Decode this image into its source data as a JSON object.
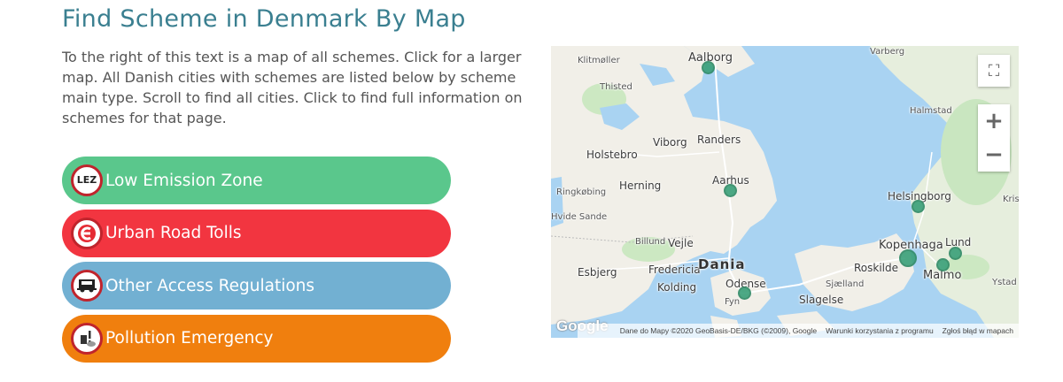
{
  "page": {
    "title": "Find Scheme in Denmark By Map",
    "intro": "To the right of this text is a map of all schemes. Click for a larger map. All Danish cities with schemes are listed below by scheme main type. Scroll to find all cities. Click to find full information on schemes for that page."
  },
  "schemes": [
    {
      "label": "Low Emission Zone",
      "color": "#5ac78c",
      "icon": "lez-sign-icon",
      "icon_text": "LEZ"
    },
    {
      "label": "Urban Road Tolls",
      "color": "#f23540",
      "icon": "road-toll-icon"
    },
    {
      "label": "Other Access Regulations",
      "color": "#72b0d2",
      "icon": "truck-prohibited-icon"
    },
    {
      "label": "Pollution Emergency",
      "color": "#f07f0e",
      "icon": "pollution-emergency-icon"
    }
  ],
  "map": {
    "country_label": "Dania",
    "cities": {
      "aalborg": "Aalborg",
      "klitmoller": "Klitmøller",
      "thisted": "Thisted",
      "varberg": "Varberg",
      "halmstad": "Halmstad",
      "viborg": "Viborg",
      "randers": "Randers",
      "holstebro": "Holstebro",
      "herning": "Herning",
      "aarhus": "Aarhus",
      "ringkobing": "Ringkøbing",
      "hvide_sande": "Hvide Sande",
      "helsingborg": "Helsingborg",
      "kris": "Kris",
      "billund": "Billund",
      "vejle": "Vejle",
      "kopenhaga": "Kopenhaga",
      "lund": "Lund",
      "esbjerg": "Esbjerg",
      "fredericia": "Fredericia",
      "roskilde": "Roskilde",
      "kolding": "Kolding",
      "odense": "Odense",
      "sjaelland": "Sjælland",
      "malmo": "Malmo",
      "ystad": "Ystad",
      "slagelse": "Slagelse",
      "fyn": "Fyn"
    },
    "controls": {
      "fullscreen": "⛶",
      "zoom_in": "+",
      "zoom_out": "−"
    },
    "google_logo": "Google",
    "attribution": {
      "data": "Dane do Mapy ©2020 GeoBasis-DE/BKG (©2009), Google",
      "terms": "Warunki korzystania z programu",
      "report": "Zgłoś błąd w mapach"
    }
  }
}
